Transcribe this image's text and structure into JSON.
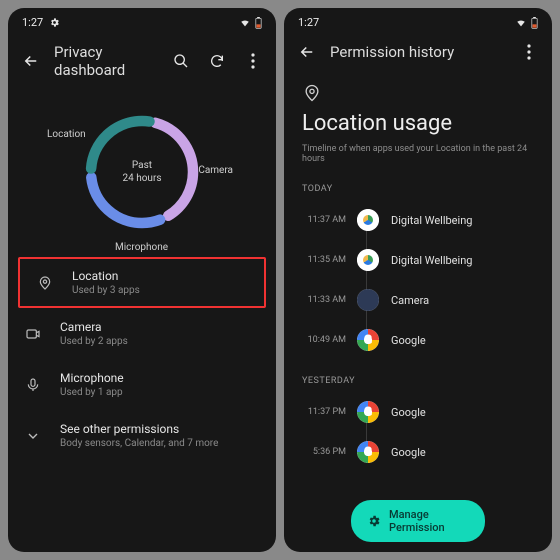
{
  "status": {
    "time": "1:27"
  },
  "left": {
    "title": "Privacy dashboard",
    "donut": {
      "center_line1": "Past",
      "center_line2": "24 hours",
      "labels": {
        "location": "Location",
        "camera": "Camera",
        "microphone": "Microphone"
      }
    },
    "rows": [
      {
        "icon": "location",
        "title": "Location",
        "sub": "Used by 3 apps",
        "highlight": true
      },
      {
        "icon": "camera",
        "title": "Camera",
        "sub": "Used by 2 apps"
      },
      {
        "icon": "mic",
        "title": "Microphone",
        "sub": "Used by 1 app"
      },
      {
        "icon": "expand",
        "title": "See other permissions",
        "sub": "Body sensors, Calendar, and 7 more"
      }
    ]
  },
  "right": {
    "title": "Permission history",
    "heading": "Location usage",
    "sub": "Timeline of when apps used your Location in the past 24 hours",
    "sections": [
      {
        "label": "TODAY",
        "items": [
          {
            "time": "11:37 AM",
            "app": "Digital Wellbeing",
            "kind": "dw"
          },
          {
            "time": "11:35 AM",
            "app": "Digital Wellbeing",
            "kind": "dw"
          },
          {
            "time": "11:33 AM",
            "app": "Camera",
            "kind": "cam"
          },
          {
            "time": "10:49 AM",
            "app": "Google",
            "kind": "g"
          }
        ]
      },
      {
        "label": "YESTERDAY",
        "items": [
          {
            "time": "11:37 PM",
            "app": "Google",
            "kind": "g"
          },
          {
            "time": "5:36 PM",
            "app": "Google",
            "kind": "g"
          }
        ]
      }
    ],
    "fab": "Manage Permission"
  },
  "chart_data": {
    "type": "pie",
    "title": "Past 24 hours",
    "series": [
      {
        "name": "Location",
        "value_label": "Used by 3 apps",
        "approx_fraction": 0.4
      },
      {
        "name": "Camera",
        "value_label": "Used by 2 apps",
        "approx_fraction": 0.33
      },
      {
        "name": "Microphone",
        "value_label": "Used by 1 app",
        "approx_fraction": 0.27
      }
    ]
  }
}
